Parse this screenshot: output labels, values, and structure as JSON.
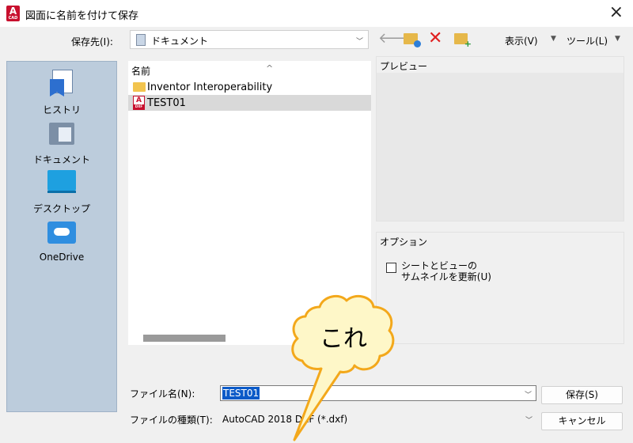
{
  "window": {
    "title": "図面に名前を付けて保存",
    "close_glyph": "×",
    "logo_letter": "A",
    "logo_sub": "CAD"
  },
  "toolbar": {
    "save_in_label": "保存先(I):",
    "save_in_value": "ドキュメント",
    "view_menu": "表示(V)",
    "tools_menu": "ツール(L)"
  },
  "places": [
    {
      "label": "ヒストリ",
      "icon": "history-icon"
    },
    {
      "label": "ドキュメント",
      "icon": "documents-icon"
    },
    {
      "label": "デスクトップ",
      "icon": "desktop-icon"
    },
    {
      "label": "OneDrive",
      "icon": "onedrive-icon"
    }
  ],
  "file_list": {
    "column_name": "名前",
    "items": [
      {
        "name": "Inventor Interoperability",
        "type": "folder",
        "selected": false
      },
      {
        "name": "TEST01",
        "type": "dxf",
        "selected": true
      }
    ],
    "dxf_icon_letter": "A",
    "dxf_icon_sub": "DXF"
  },
  "preview": {
    "title": "プレビュー"
  },
  "options": {
    "title": "オプション",
    "checkbox_line1": "シートとビューの",
    "checkbox_line2": "サムネイルを更新(U)",
    "checked": false
  },
  "callout": {
    "text": "これ"
  },
  "bottom": {
    "file_name_label": "ファイル名(N):",
    "file_name_value": "TEST01",
    "file_type_label": "ファイルの種類(T):",
    "file_type_value": "AutoCAD 2018 DXF (*.dxf)",
    "save_button": "保存(S)",
    "cancel_button": "キャンセル"
  },
  "colors": {
    "accent": "#0b5ac8",
    "places_bg": "#bcccdc",
    "autocad_red": "#c8102e",
    "callout_fill": "#fef7c8",
    "callout_stroke": "#f3a81b"
  }
}
